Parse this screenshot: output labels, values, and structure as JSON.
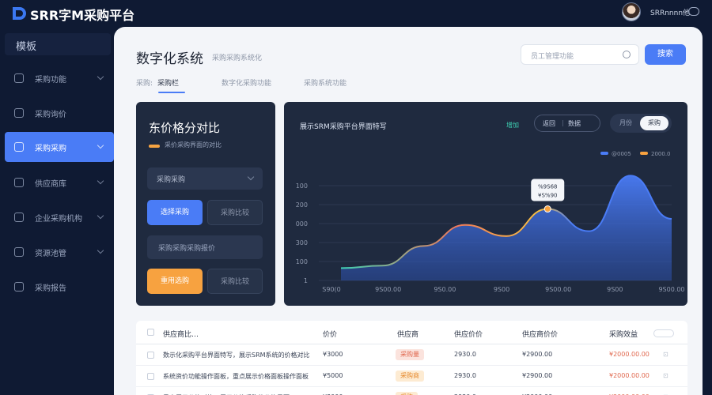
{
  "header": {
    "app_title": "SRR字M采购平台",
    "username": "SRRnnnn他",
    "logo_icon": "srm-logo-icon",
    "avatar_icon": "user-avatar",
    "chat_icon": "chat-bubble-icon"
  },
  "sidebar": {
    "heading": "模板",
    "items": [
      {
        "label": "采购功能",
        "icon": "grid-icon"
      },
      {
        "label": "采购询价",
        "icon": "doc-icon"
      },
      {
        "label": "采购采购",
        "icon": "cart-icon",
        "active": true
      },
      {
        "label": "供应商库",
        "icon": "box-icon"
      },
      {
        "label": "企业采购机构",
        "icon": "org-icon"
      },
      {
        "label": "资源池管",
        "icon": "folder-icon"
      },
      {
        "label": "采购报告",
        "icon": "report-icon"
      }
    ]
  },
  "main": {
    "title": "数字化系统",
    "subtitle": "采购采购系统化",
    "search_placeholder": "员工管理功能",
    "search_button": "搜索",
    "tabs": [
      "采购:",
      "采购栏",
      "数字化采购功能",
      "采购系统功能"
    ]
  },
  "compare_card": {
    "title": "东价格分对比",
    "subtitle": "采价采购界面的对比",
    "select_value": "采购采购",
    "btn_primary": "选择采购",
    "btn_secondary": "采购比较",
    "input_placeholder": "采购采购采购报价",
    "btn_orange": "重用选购",
    "btn_ghost": "采购比较"
  },
  "chart_card": {
    "title": "展示SRM采购平台界面特写",
    "tag": "增加",
    "segment_left": "返回",
    "segment_right": "数据",
    "toggle_off": "月份",
    "toggle_on": "采购",
    "tooltip_line1": "%9S68",
    "tooltip_line2": "¥S%90"
  },
  "chart_data": {
    "type": "area",
    "yticks": [
      "100",
      "200",
      "000",
      "300",
      "100",
      "1"
    ],
    "xticks": [
      "S90(0",
      "9S00.00",
      "9S0.00",
      "9S00",
      "9S00.00",
      "9S00",
      "9S00.00"
    ],
    "series": [
      {
        "name": "@0005",
        "color": "#4a7cf6",
        "values": [
          0.1,
          0.12,
          0.28,
          0.45,
          0.36,
          0.58,
          0.4,
          0.85,
          0.5
        ]
      },
      {
        "name": "2000.0",
        "color": "#f7a240"
      }
    ],
    "ylim": [
      0,
      1
    ],
    "colors": {
      "accent": "#4a7cf6",
      "orange": "#f7a240",
      "teal": "#3ecfb2"
    }
  },
  "table": {
    "columns": [
      "供应商比…",
      "价价",
      "供应商",
      "供应价价",
      "供应商价价",
      "采购效益"
    ],
    "rows": [
      [
        "数示化采购平台界面特写，展示SRM系统的价格对比",
        "¥3000",
        "采购量",
        "2930.0",
        "¥2900.00",
        "¥2000.00.00"
      ],
      [
        "系统资价功能操作面板，重点展示价格面板操作面板",
        "¥5000",
        "采购商",
        "2930.0",
        "¥2900.00",
        "¥2000.00.00"
      ],
      [
        "重点展示价格对比，展示价格采购的价格界面",
        "¥3000",
        "采购",
        "2930.0",
        "¥2000.00",
        "¥2000.00.00"
      ]
    ],
    "badge_colors": [
      {
        "bg": "#fbe3dd",
        "fg": "#e0684e"
      },
      {
        "bg": "#fdebd2",
        "fg": "#e68a2e"
      },
      {
        "bg": "#fdebd2",
        "fg": "#e68a2e"
      }
    ]
  }
}
